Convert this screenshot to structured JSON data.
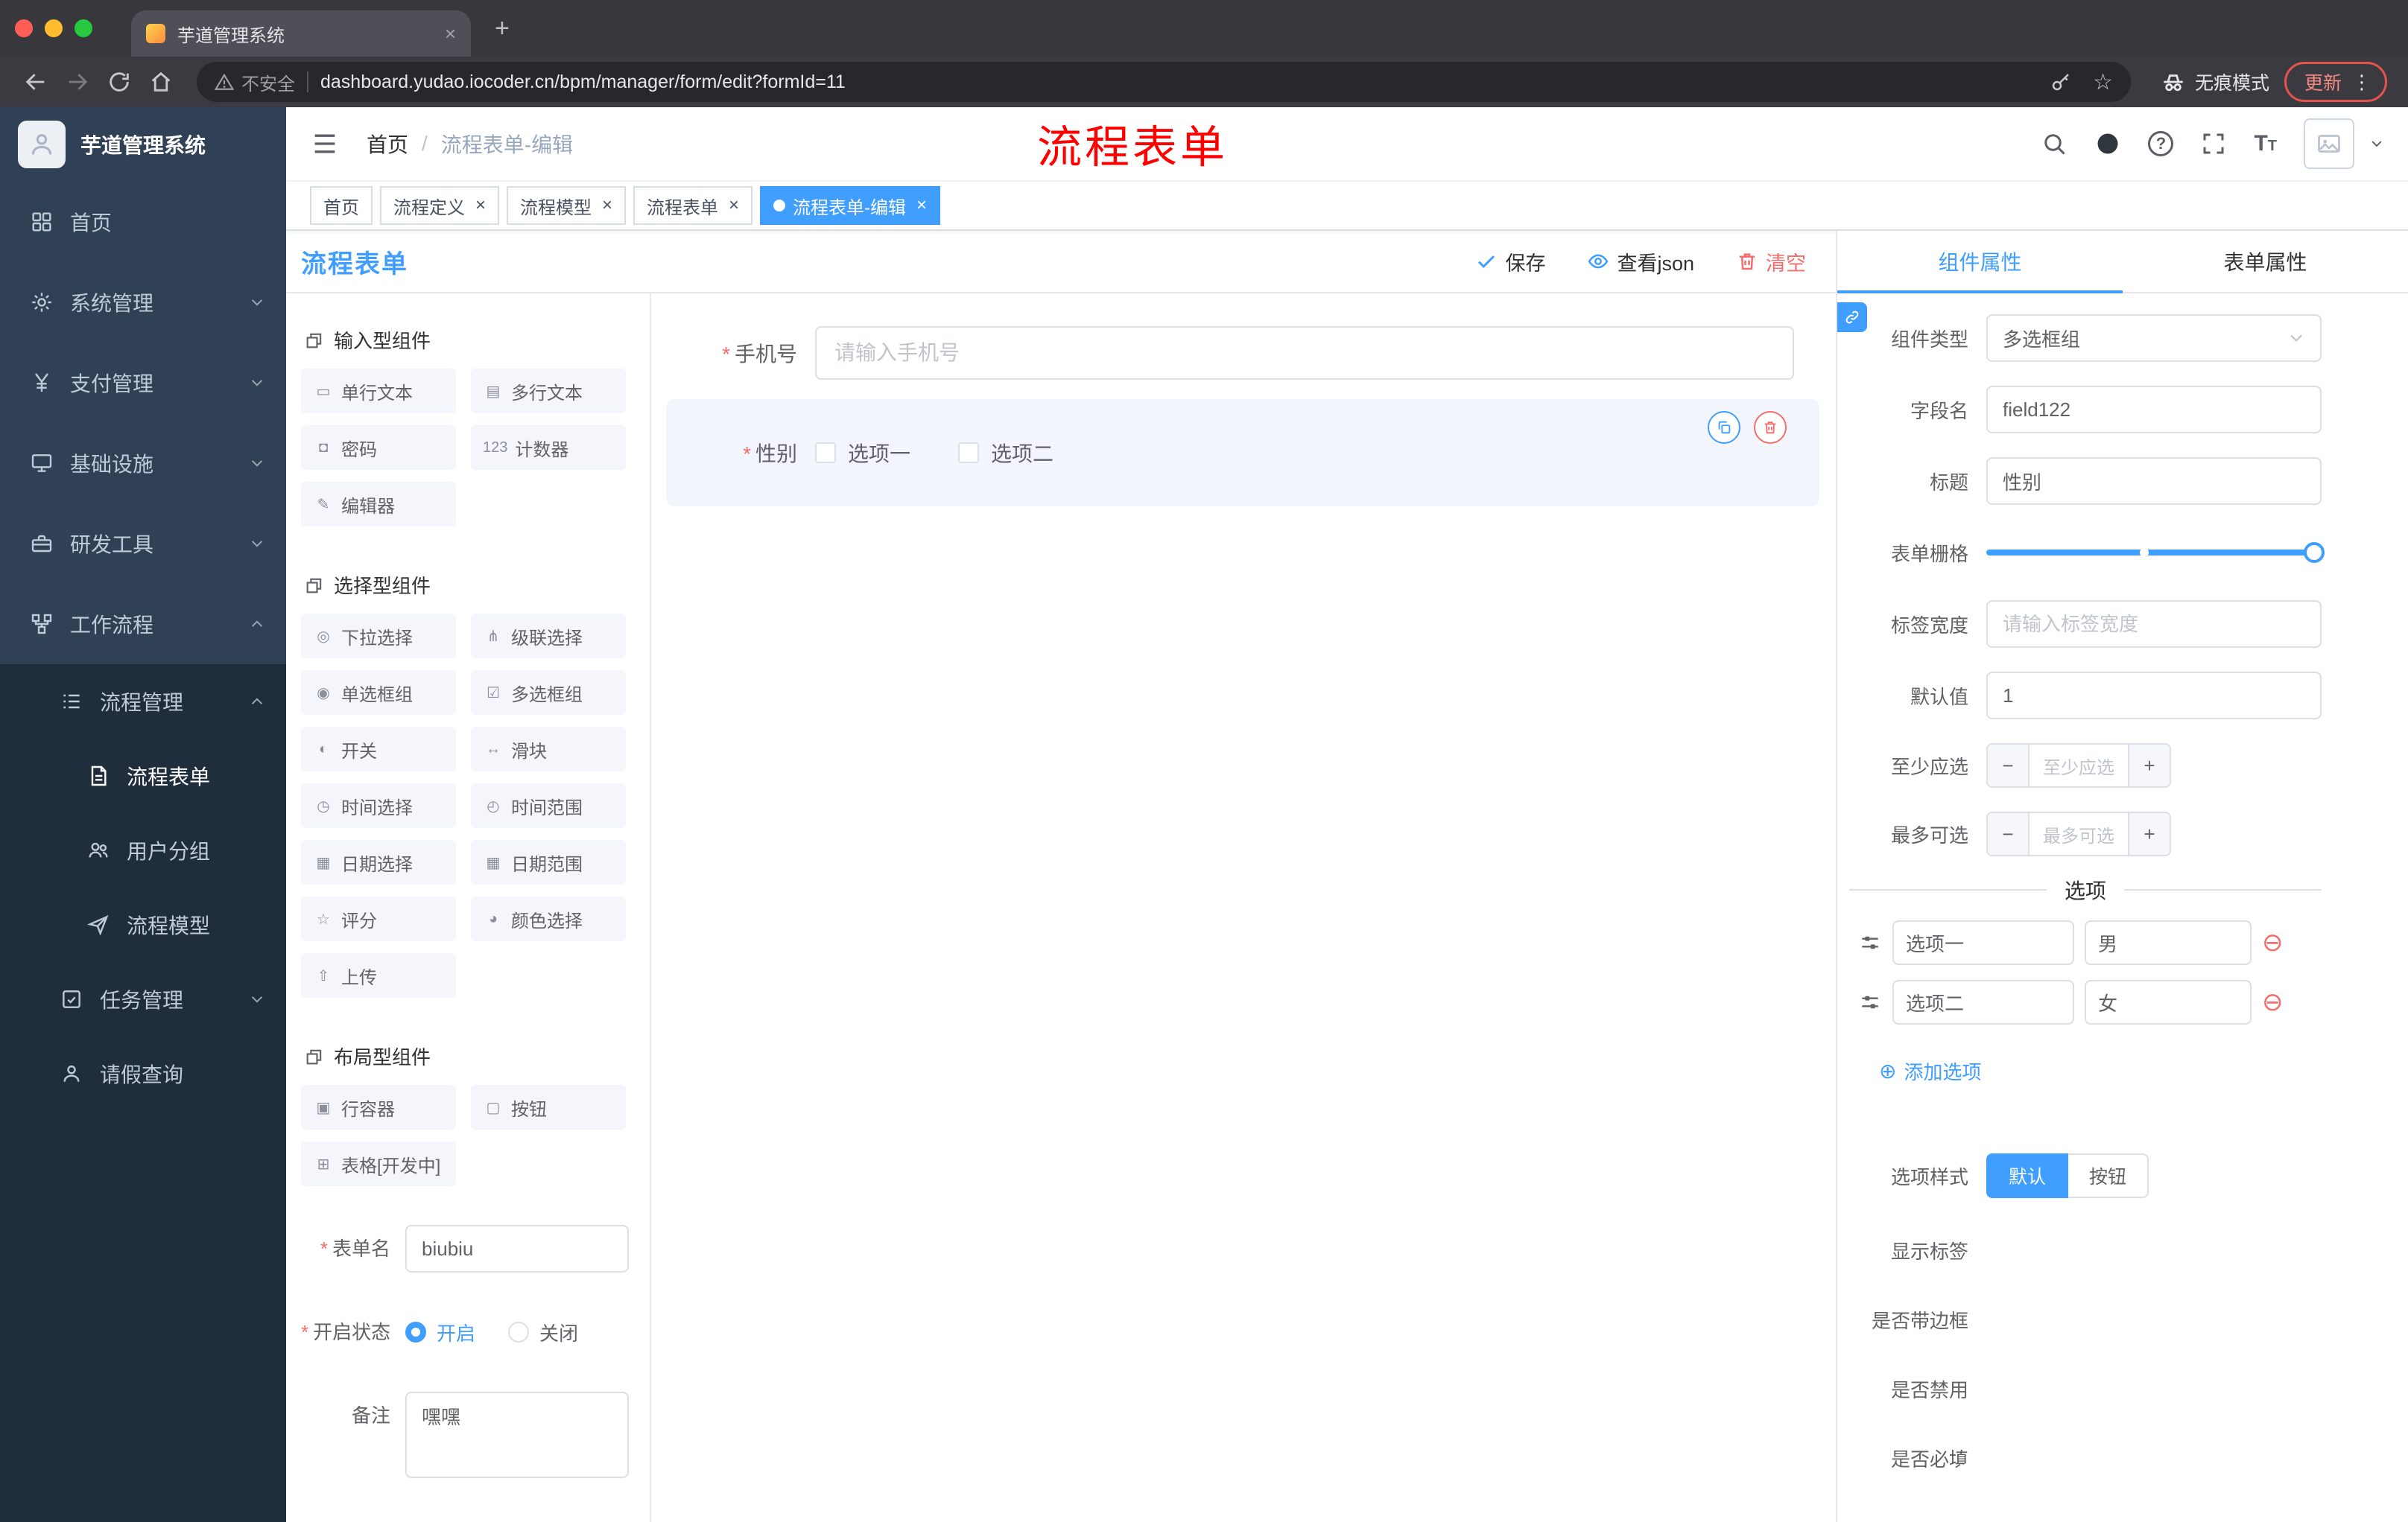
{
  "colors": {
    "accent": "#409eff",
    "danger": "#f56c6c",
    "sidebar_bg": "#304156",
    "sidebar_sub_bg": "#1f2d3d"
  },
  "browser": {
    "tab_title": "芋道管理系统",
    "close_tab": "×",
    "new_tab": "+",
    "security_label": "不安全",
    "url": "dashboard.yudao.iocoder.cn/bpm/manager/form/edit?formId=11",
    "incognito_label": "无痕模式",
    "update_label": "更新",
    "menu_dots": "⋮"
  },
  "sidebar": {
    "logo_title": "芋道管理系统",
    "items": [
      {
        "label": "首页",
        "icon": "dashboard-icon"
      },
      {
        "label": "系统管理",
        "icon": "gear-icon"
      },
      {
        "label": "支付管理",
        "icon": "yen-icon"
      },
      {
        "label": "基础设施",
        "icon": "monitor-icon"
      },
      {
        "label": "研发工具",
        "icon": "toolbox-icon"
      },
      {
        "label": "工作流程",
        "icon": "workflow-icon"
      },
      {
        "label": "流程管理",
        "icon": "list-icon"
      },
      {
        "label": "流程表单",
        "icon": "document-icon"
      },
      {
        "label": "用户分组",
        "icon": "users-icon"
      },
      {
        "label": "流程模型",
        "icon": "send-icon"
      },
      {
        "label": "任务管理",
        "icon": "tasks-icon"
      },
      {
        "label": "请假查询",
        "icon": "user-icon"
      }
    ]
  },
  "navbar": {
    "breadcrumb_home": "首页",
    "breadcrumb_sep": "/",
    "breadcrumb_current": "流程表单-编辑",
    "annotation": "流程表单",
    "help_glyph": "?",
    "fontsize_glyph": "T"
  },
  "tags_view": {
    "close_glyph": "×",
    "tabs": [
      {
        "label": "首页"
      },
      {
        "label": "流程定义"
      },
      {
        "label": "流程模型"
      },
      {
        "label": "流程表单"
      },
      {
        "label": "流程表单-编辑"
      }
    ]
  },
  "designer": {
    "title": "流程表单",
    "actions": {
      "save": "保存",
      "view_json": "查看json",
      "clear": "清空"
    },
    "palette": {
      "sections": [
        {
          "title": "输入型组件",
          "items": [
            {
              "icon": "▭",
              "label": "单行文本"
            },
            {
              "icon": "▤",
              "label": "多行文本"
            },
            {
              "icon": "◘",
              "label": "密码"
            },
            {
              "icon": "123",
              "label": "计数器"
            },
            {
              "icon": "✎",
              "label": "编辑器"
            }
          ]
        },
        {
          "title": "选择型组件",
          "items": [
            {
              "icon": "◎",
              "label": "下拉选择"
            },
            {
              "icon": "⋔",
              "label": "级联选择"
            },
            {
              "icon": "◉",
              "label": "单选框组"
            },
            {
              "icon": "☑",
              "label": "多选框组"
            },
            {
              "icon": "◐",
              "label": "开关"
            },
            {
              "icon": "↔",
              "label": "滑块"
            },
            {
              "icon": "◷",
              "label": "时间选择"
            },
            {
              "icon": "◴",
              "label": "时间范围"
            },
            {
              "icon": "▦",
              "label": "日期选择"
            },
            {
              "icon": "▦",
              "label": "日期范围"
            },
            {
              "icon": "☆",
              "label": "评分"
            },
            {
              "icon": "◕",
              "label": "颜色选择"
            },
            {
              "icon": "⇧",
              "label": "上传"
            }
          ]
        },
        {
          "title": "布局型组件",
          "items": [
            {
              "icon": "▣",
              "label": "行容器"
            },
            {
              "icon": "▢",
              "label": "按钮"
            },
            {
              "icon": "⊞",
              "label": "表格[开发中]"
            }
          ]
        }
      ]
    },
    "meta_form": {
      "name_label": "表单名",
      "name_value": "biubiu",
      "status_label": "开启状态",
      "status_on": "开启",
      "status_off": "关闭",
      "remark_label": "备注",
      "remark_value": "嘿嘿"
    },
    "canvas": {
      "phone_label": "手机号",
      "phone_placeholder": "请输入手机号",
      "gender_label": "性别",
      "gender_option1": "选项一",
      "gender_option2": "选项二"
    }
  },
  "props": {
    "tab_component": "组件属性",
    "tab_form": "表单属性",
    "component_type_label": "组件类型",
    "component_type_value": "多选框组",
    "field_name_label": "字段名",
    "field_name_value": "field122",
    "title_label": "标题",
    "title_value": "性别",
    "grid_label": "表单栅格",
    "label_width_label": "标签宽度",
    "label_width_placeholder": "请输入标签宽度",
    "default_label": "默认值",
    "default_value": "1",
    "min_label": "至少应选",
    "min_placeholder": "至少应选",
    "max_label": "最多可选",
    "max_placeholder": "最多可选",
    "minus_glyph": "−",
    "plus_glyph": "+",
    "options_divider": "选项",
    "options": [
      {
        "label": "选项一",
        "value": "男"
      },
      {
        "label": "选项二",
        "value": "女"
      }
    ],
    "remove_glyph": "⊖",
    "add_glyph": "⊕",
    "add_option_label": "添加选项",
    "option_style_label": "选项样式",
    "option_style_default": "默认",
    "option_style_button": "按钮",
    "switch_show_label": "显示标签",
    "switch_border": "是否带边框",
    "switch_disabled": "是否禁用",
    "switch_required": "是否必填"
  }
}
